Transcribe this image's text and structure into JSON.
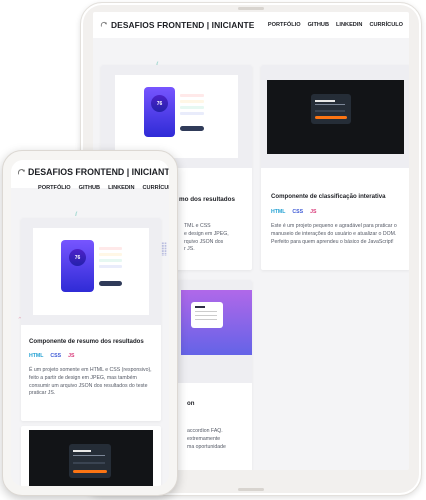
{
  "site": {
    "title": "DESAFIOS FRONTEND | INICIANTE",
    "logo_icon": "arrow-swirl-icon"
  },
  "nav": [
    "PORTFÓLIO",
    "GITHUB",
    "LINKEDIN",
    "CURRÍCULO"
  ],
  "tablet": {
    "cards": [
      {
        "title": "Componente de resumo dos resultados",
        "title_visible_fragment": "mo dos resultados",
        "desc_visible_fragment": "TML e CSS\ne design em JPEG,\nrquivo JSON dos\nr JS.",
        "thumb": "results-summary"
      },
      {
        "title": "Componente de classificação interativa",
        "tags": [
          "HTML",
          "CSS",
          "JS"
        ],
        "description": "Este é um projeto pequeno e agradável para praticar o manuseio de interações do usuário e atualizar o DOM. Perfeito para quem aprendeu o básico de JavaScript!",
        "thumb": "interactive-rating"
      },
      {
        "title_visible_fragment": "on",
        "desc_visible_fragment": "accordion FAQ.\nextremamente\nma oportunidade",
        "thumb": "faq-accordion"
      }
    ]
  },
  "phone": {
    "cards": [
      {
        "title": "Componente de resumo dos resultados",
        "tags": [
          "HTML",
          "CSS",
          "JS"
        ],
        "description": "É um projeto somente em HTML e CSS (responsivo), feito a partir de design em JPEG, mas também consumir um arquivo JSON dos resultados do teste praticar JS.",
        "thumb": "results-summary",
        "score": "76"
      },
      {
        "thumb": "interactive-rating"
      }
    ]
  },
  "colors": {
    "html_tag": "#1f9fd2",
    "css_tag": "#3d5ad6",
    "js_tag": "#d93b7a",
    "rating_orange": "#fb7413",
    "results_purple": "#5a3ff0"
  }
}
